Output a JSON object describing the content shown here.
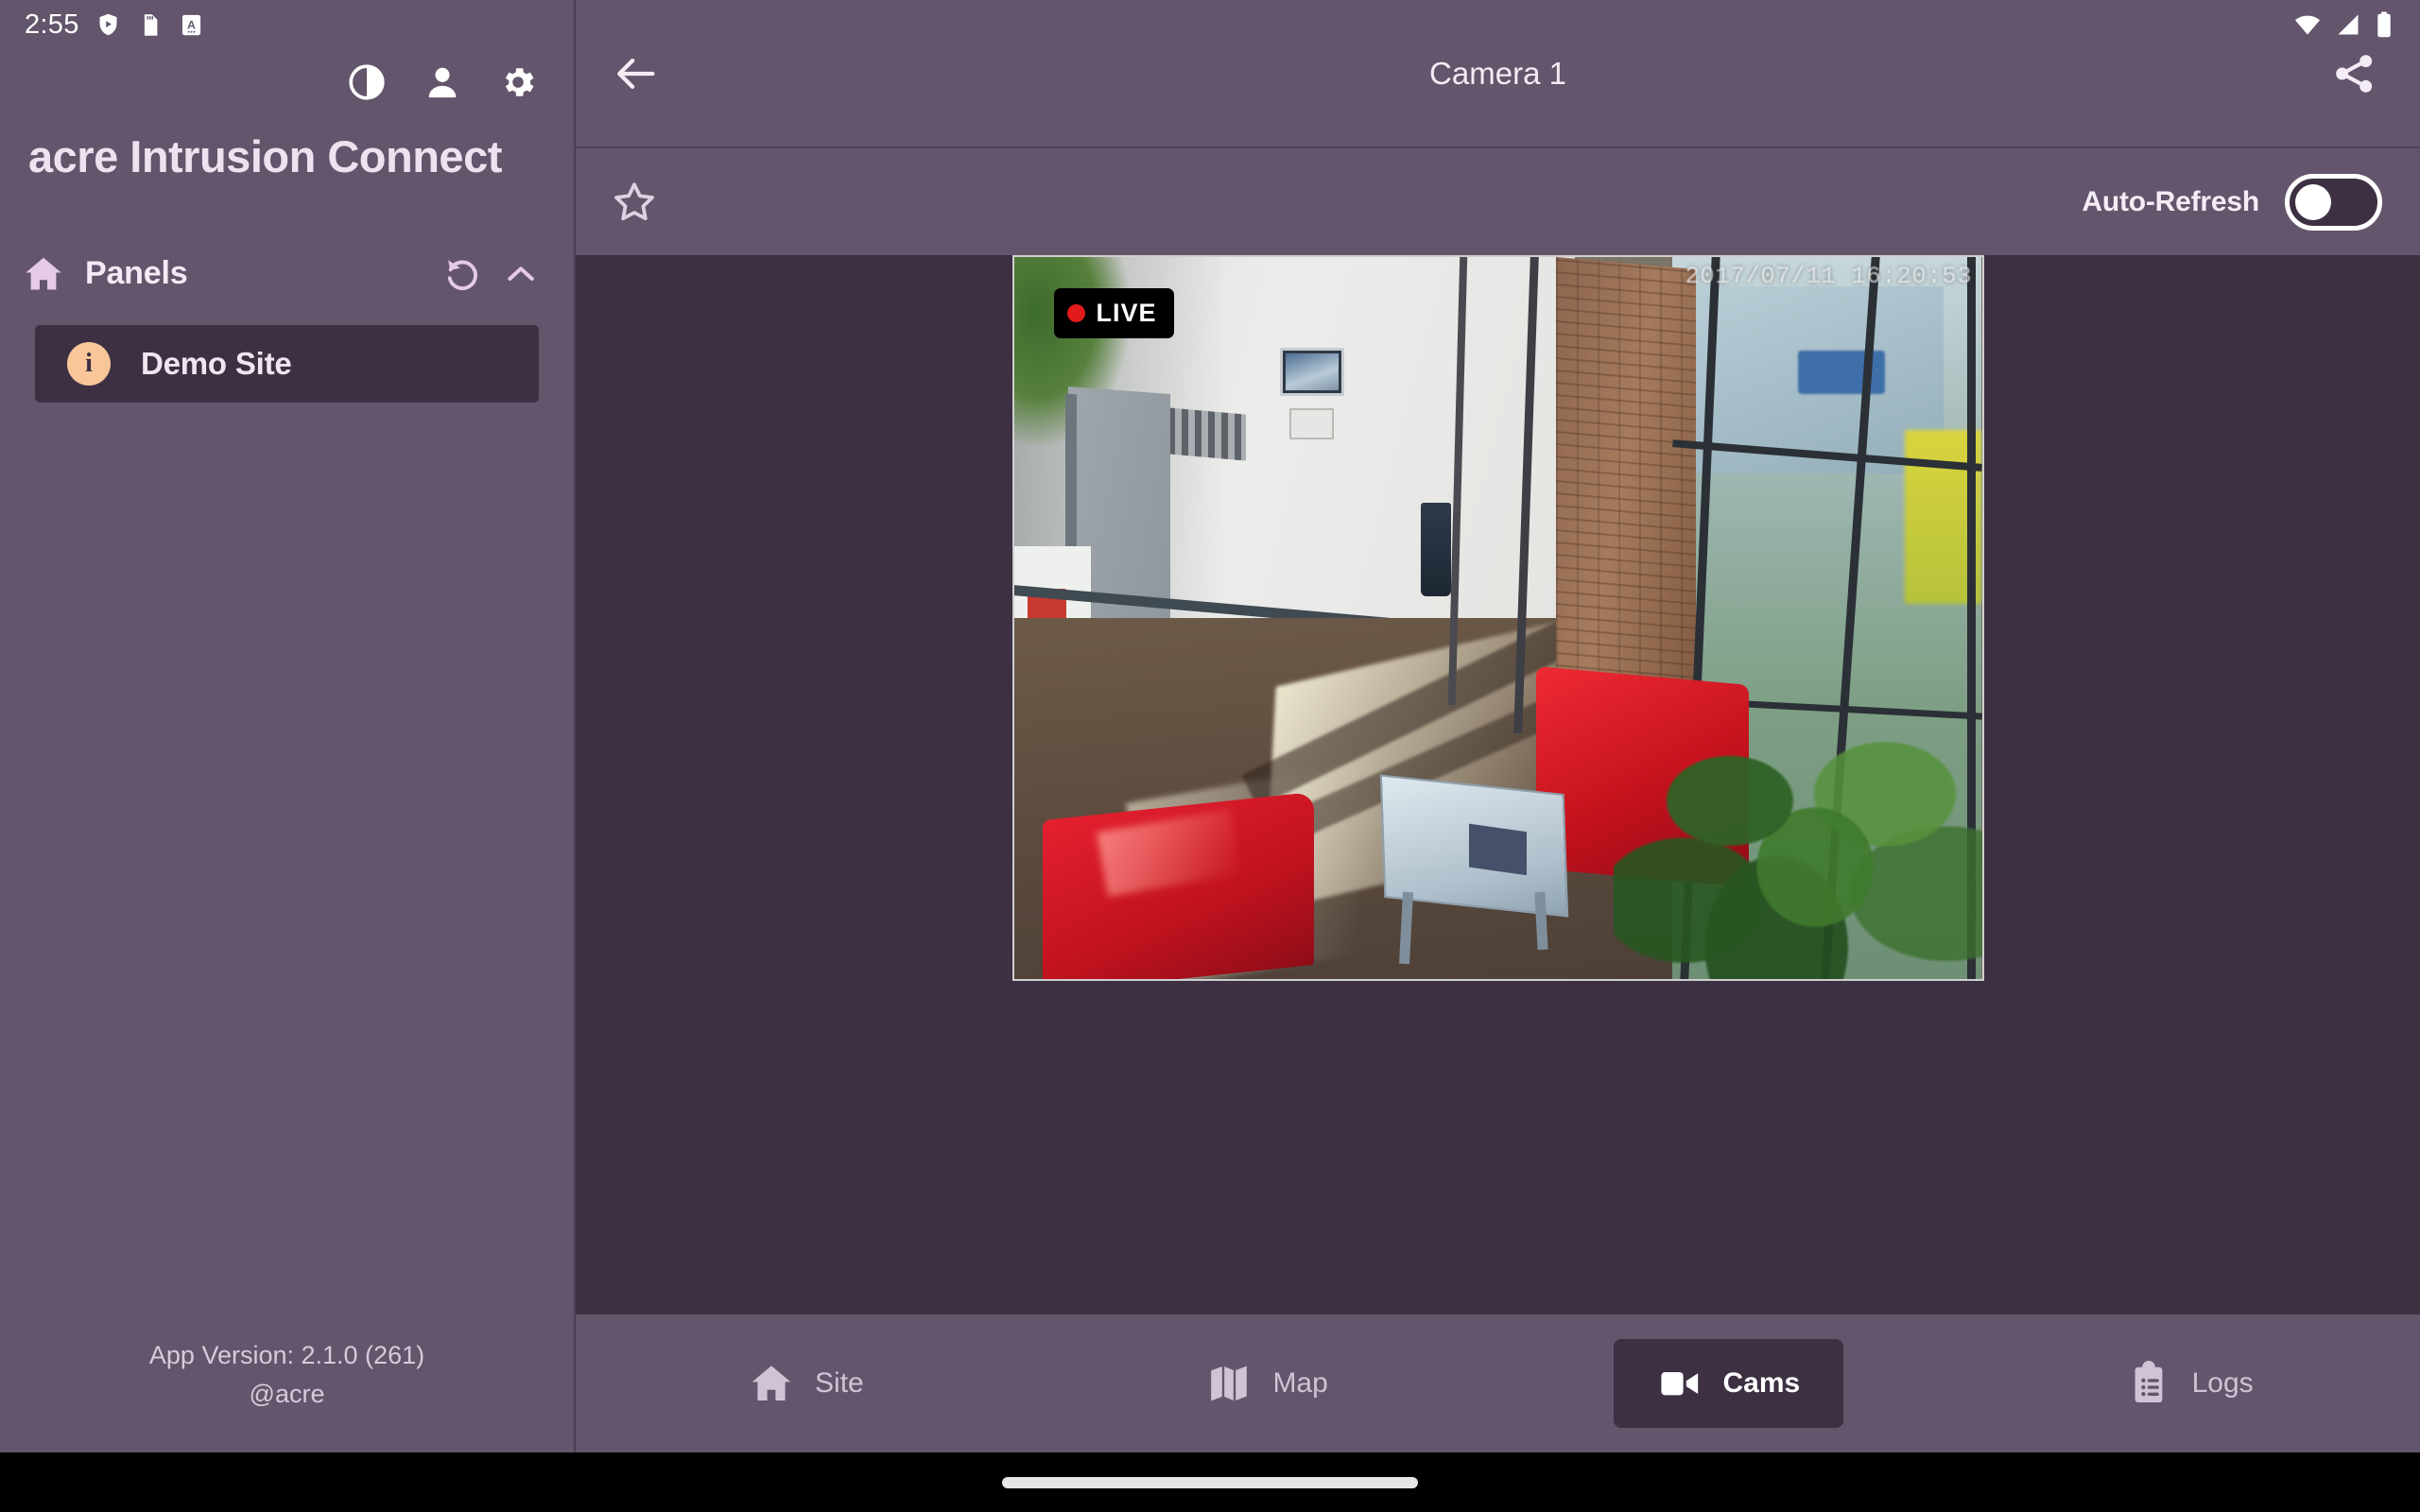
{
  "status_bar": {
    "clock": "2:55",
    "left_icons": [
      "shield-play-icon",
      "sd-card-icon",
      "letter-a-icon"
    ],
    "right_icons": [
      "wifi-icon",
      "cellular-signal-icon",
      "battery-icon"
    ]
  },
  "sidebar": {
    "actions": [
      {
        "name": "theme-contrast-icon",
        "label": "Theme"
      },
      {
        "name": "account-icon",
        "label": "Account"
      },
      {
        "name": "settings-gear-icon",
        "label": "Settings"
      }
    ],
    "brand_title": "acre Intrusion Connect",
    "panels_section": {
      "icon": "home-icon",
      "title": "Panels",
      "refresh_icon": "refresh-ccw-icon",
      "collapse_icon": "chevron-up-icon",
      "items": [
        {
          "badge": "i",
          "label": "Demo Site"
        }
      ]
    },
    "footer": {
      "version": "App Version: 2.1.0 (261)",
      "handle": "@acre"
    }
  },
  "topbar": {
    "back_icon": "arrow-left-icon",
    "title": "Camera 1",
    "share_icon": "share-icon"
  },
  "toolbar": {
    "favorite_icon": "star-outline-icon",
    "auto_refresh_label": "Auto-Refresh",
    "auto_refresh_on": false
  },
  "camera": {
    "live_label": "LIVE",
    "timestamp": "2017/07/11 16:20:53",
    "scene_description": "Interior lobby with white walls, wooden floor, red sofas, glass curtain wall and palm plants"
  },
  "bottom_nav": {
    "items": [
      {
        "icon": "home-icon",
        "label": "Site",
        "active": false
      },
      {
        "icon": "map-icon",
        "label": "Map",
        "active": false
      },
      {
        "icon": "video-camera-icon",
        "label": "Cams",
        "active": true
      },
      {
        "icon": "clipboard-list-icon",
        "label": "Logs",
        "active": false
      }
    ]
  },
  "colors": {
    "sidebar_bg": "#63556B",
    "content_bg": "#3D3042",
    "accent_peach": "#F9C69A",
    "text_light": "#EFE6F2",
    "live_red": "#E11B1B"
  }
}
